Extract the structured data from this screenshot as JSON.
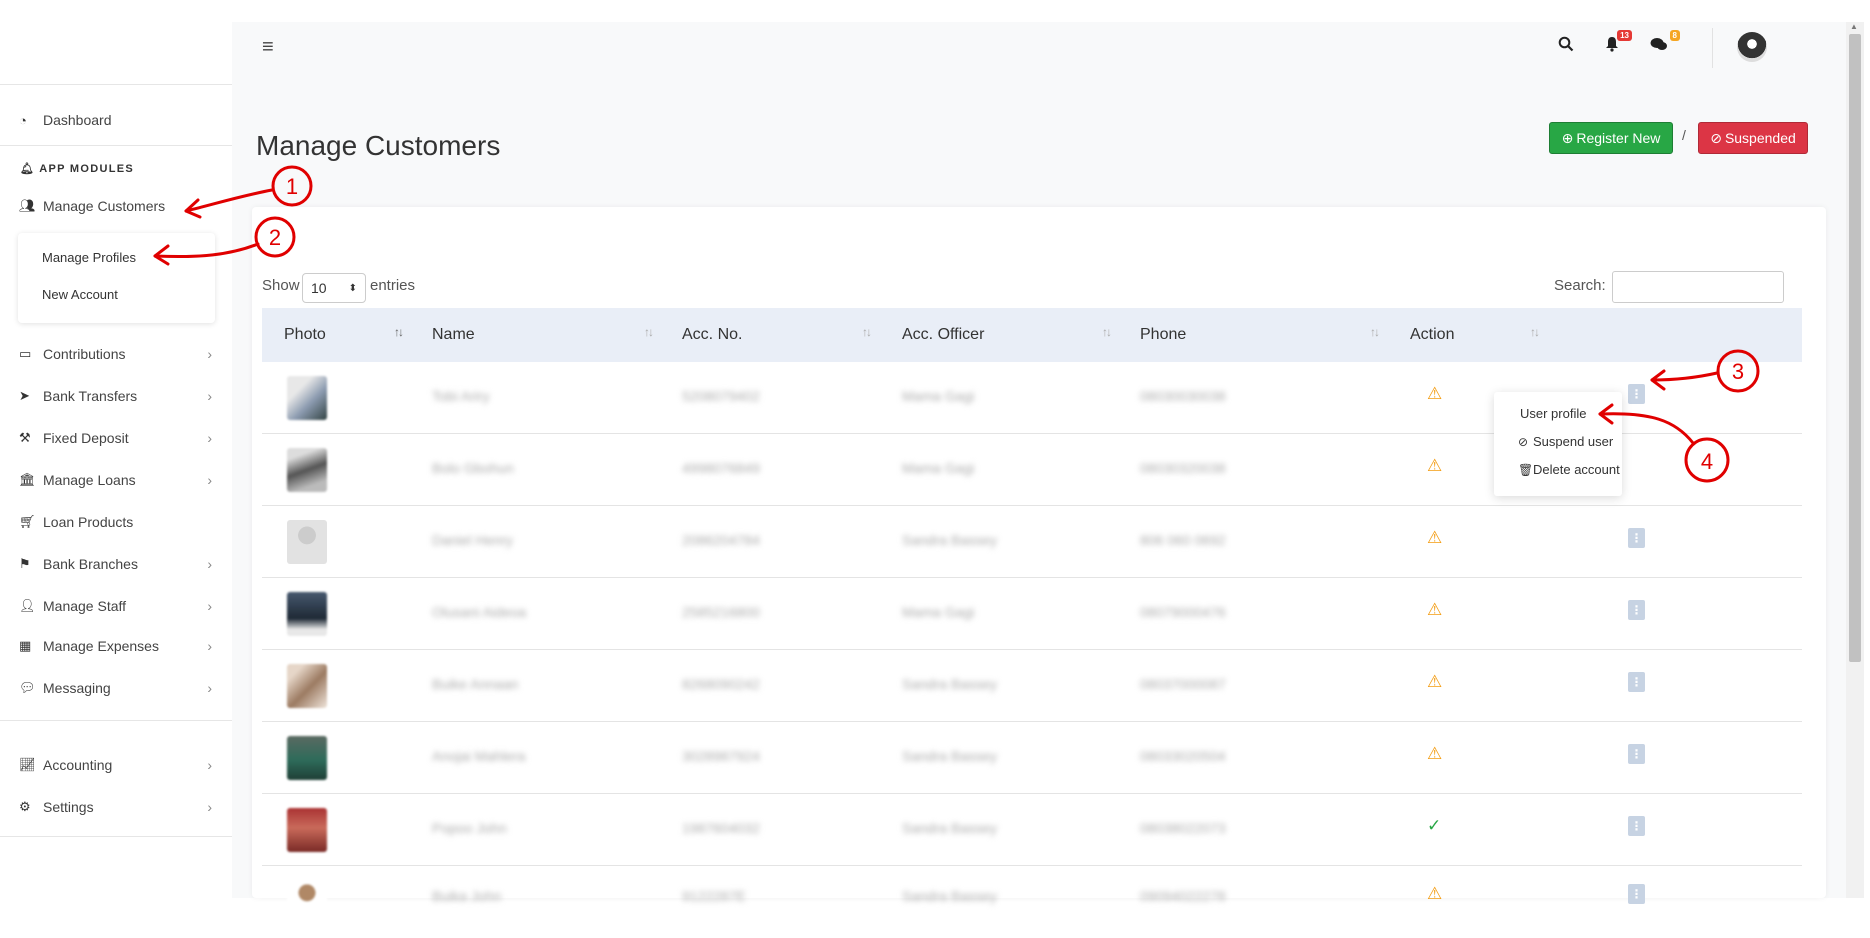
{
  "sidebar": {
    "dashboard": "Dashboard",
    "section_title": "APP MODULES",
    "items": [
      {
        "label": "Manage Customers",
        "icon": "users-icon"
      },
      {
        "label": "Contributions",
        "icon": "money-icon"
      },
      {
        "label": "Bank Transfers",
        "icon": "paper-plane-icon"
      },
      {
        "label": "Fixed Deposit",
        "icon": "gavel-icon"
      },
      {
        "label": "Manage Loans",
        "icon": "bank-icon"
      },
      {
        "label": "Loan Products",
        "icon": "cart-icon"
      },
      {
        "label": "Bank Branches",
        "icon": "flag-icon"
      },
      {
        "label": "Manage Staff",
        "icon": "user-icon"
      },
      {
        "label": "Manage Expenses",
        "icon": "calculator-icon"
      },
      {
        "label": "Messaging",
        "icon": "comments-icon"
      },
      {
        "label": "Accounting",
        "icon": "chart-icon"
      },
      {
        "label": "Settings",
        "icon": "cog-icon"
      }
    ],
    "submenu": [
      "Manage Profiles",
      "New Account"
    ]
  },
  "topbar": {
    "notifications_count": "13",
    "messages_count": "8"
  },
  "header": {
    "title": "Manage Customers",
    "register_btn": "Register New",
    "separator": "/",
    "suspended_btn": "Suspended"
  },
  "table_controls": {
    "show": "Show",
    "length_value": "10",
    "entries": "entries",
    "search": "Search:"
  },
  "table": {
    "columns": [
      "Photo",
      "Name",
      "Acc. No.",
      "Acc. Officer",
      "Phone",
      "Action"
    ],
    "rows": [
      {
        "name": "Tobi Ariry",
        "acc": "5208079402",
        "officer": "Mama Gagi",
        "phone": "08030030038",
        "status": "warn"
      },
      {
        "name": "Bolo Gbohun",
        "acc": "4998076849",
        "officer": "Mama Gagi",
        "phone": "08030320038",
        "status": "warn"
      },
      {
        "name": "Daniel Henry",
        "acc": "2086204784",
        "officer": "Sandra Bassey",
        "phone": "806 060 0692",
        "status": "warn"
      },
      {
        "name": "Olusani Aideoa",
        "acc": "2585216800",
        "officer": "Mama Gagi",
        "phone": "08079000476",
        "status": "warn"
      },
      {
        "name": "Buike Annaan",
        "acc": "8268090242",
        "officer": "Sandra Bassey",
        "phone": "08037000087",
        "status": "warn"
      },
      {
        "name": "Anojai Mahlera",
        "acc": "3028987924",
        "officer": "Sandra Bassey",
        "phone": "08033020504",
        "status": "warn"
      },
      {
        "name": "Popoo John",
        "acc": "1987604032",
        "officer": "Sandra Bassey",
        "phone": "08038022073",
        "status": "ok"
      },
      {
        "name": "Buika John",
        "acc": "9122287E",
        "officer": "Sandra Bassey",
        "phone": "09094022278",
        "status": "warn"
      }
    ]
  },
  "action_menu": {
    "items": [
      "User profile",
      "Suspend user",
      "Delete account"
    ]
  },
  "annotations": [
    "1",
    "2",
    "3",
    "4"
  ],
  "colors": {
    "success": "#28a745",
    "danger": "#dc3545",
    "warning": "#f39c12",
    "annotation": "#e00000"
  }
}
